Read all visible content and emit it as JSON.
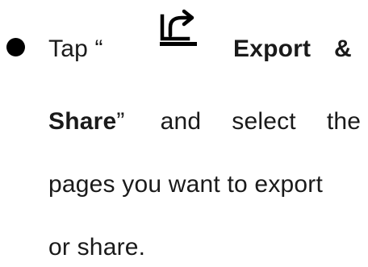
{
  "instruction": {
    "tap_prefix": "Tap “",
    "button_name": "Export",
    "ampersand": "&",
    "button_name_cont": "Share",
    "quote_suffix": "”",
    "word_and": "and",
    "word_select": "select",
    "word_the": "the",
    "line3": "pages you want to export",
    "line4": "or share.",
    "icon": "export-share-icon"
  }
}
